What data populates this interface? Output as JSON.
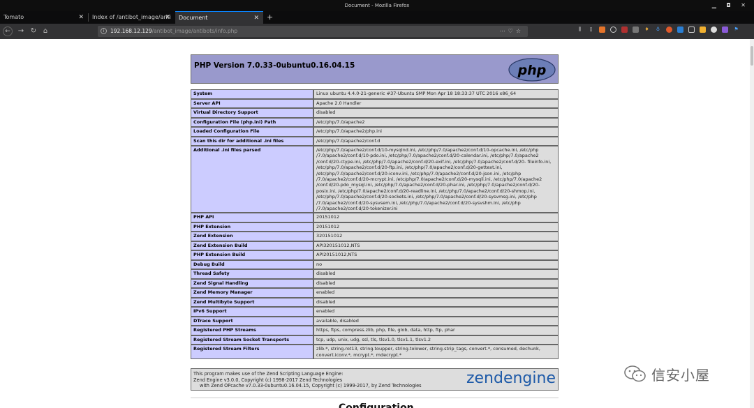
{
  "window": {
    "title": "Document - Mozilla Firefox"
  },
  "tabs": [
    {
      "label": "Tomato"
    },
    {
      "label": "Index of /antibot_image/anti"
    },
    {
      "label": "Document"
    }
  ],
  "navbar": {
    "url_host": "192.168.12.129",
    "url_path": "/antibot_image/antibots/info.php"
  },
  "php": {
    "version_title": "PHP Version 7.0.33-0ubuntu0.16.04.15",
    "logo_text": "php"
  },
  "rows": [
    {
      "key": "System",
      "value": "Linux ubuntu 4.4.0-21-generic #37-Ubuntu SMP Mon Apr 18 18:33:37 UTC 2016 x86_64"
    },
    {
      "key": "Server API",
      "value": "Apache 2.0 Handler"
    },
    {
      "key": "Virtual Directory Support",
      "value": "disabled"
    },
    {
      "key": "Configuration File (php.ini) Path",
      "value": "/etc/php/7.0/apache2"
    },
    {
      "key": "Loaded Configuration File",
      "value": "/etc/php/7.0/apache2/php.ini"
    },
    {
      "key": "Scan this dir for additional .ini files",
      "value": "/etc/php/7.0/apache2/conf.d"
    },
    {
      "key": "Additional .ini files parsed",
      "value": "/etc/php/7.0/apache2/conf.d/10-mysqlnd.ini, /etc/php/7.0/apache2/conf.d/10-opcache.ini, /etc/php /7.0/apache2/conf.d/10-pdo.ini, /etc/php/7.0/apache2/conf.d/20-calendar.ini, /etc/php/7.0/apache2 /conf.d/20-ctype.ini, /etc/php/7.0/apache2/conf.d/20-exif.ini, /etc/php/7.0/apache2/conf.d/20- fileinfo.ini, /etc/php/7.0/apache2/conf.d/20-ftp.ini, /etc/php/7.0/apache2/conf.d/20-gettext.ini, /etc/php/7.0/apache2/conf.d/20-iconv.ini, /etc/php/7.0/apache2/conf.d/20-json.ini, /etc/php /7.0/apache2/conf.d/20-mcrypt.ini, /etc/php/7.0/apache2/conf.d/20-mysqli.ini, /etc/php/7.0/apache2 /conf.d/20-pdo_mysql.ini, /etc/php/7.0/apache2/conf.d/20-phar.ini, /etc/php/7.0/apache2/conf.d/20- posix.ini, /etc/php/7.0/apache2/conf.d/20-readline.ini, /etc/php/7.0/apache2/conf.d/20-shmop.ini, /etc/php/7.0/apache2/conf.d/20-sockets.ini, /etc/php/7.0/apache2/conf.d/20-sysvmsg.ini, /etc/php /7.0/apache2/conf.d/20-sysvsem.ini, /etc/php/7.0/apache2/conf.d/20-sysvshm.ini, /etc/php /7.0/apache2/conf.d/20-tokenizer.ini"
    },
    {
      "key": "PHP API",
      "value": "20151012"
    },
    {
      "key": "PHP Extension",
      "value": "20151012"
    },
    {
      "key": "Zend Extension",
      "value": "320151012"
    },
    {
      "key": "Zend Extension Build",
      "value": "API320151012,NTS"
    },
    {
      "key": "PHP Extension Build",
      "value": "API20151012,NTS"
    },
    {
      "key": "Debug Build",
      "value": "no"
    },
    {
      "key": "Thread Safety",
      "value": "disabled"
    },
    {
      "key": "Zend Signal Handling",
      "value": "disabled"
    },
    {
      "key": "Zend Memory Manager",
      "value": "enabled"
    },
    {
      "key": "Zend Multibyte Support",
      "value": "disabled"
    },
    {
      "key": "IPv6 Support",
      "value": "enabled"
    },
    {
      "key": "DTrace Support",
      "value": "available, disabled"
    },
    {
      "key": "Registered PHP Streams",
      "value": "https, ftps, compress.zlib, php, file, glob, data, http, ftp, phar"
    },
    {
      "key": "Registered Stream Socket Transports",
      "value": "tcp, udp, unix, udg, ssl, tls, tlsv1.0, tlsv1.1, tlsv1.2"
    },
    {
      "key": "Registered Stream Filters",
      "value": "zlib.*, string.rot13, string.toupper, string.tolower, string.strip_tags, convert.*, consumed, dechunk, convert.iconv.*, mcrypt.*, mdecrypt.*"
    }
  ],
  "footer": {
    "line1": "This program makes use of the Zend Scripting Language Engine:",
    "line2": "Zend Engine v3.0.0, Copyright (c) 1998-2017 Zend Technologies",
    "line3": "with Zend OPcache v7.0.33-0ubuntu0.16.04.15, Copyright (c) 1999-2017, by Zend Technologies",
    "logo_zend": "zend",
    "logo_engine": "engine"
  },
  "config_heading": "Configuration",
  "watermark": {
    "text": "信安小屋"
  }
}
